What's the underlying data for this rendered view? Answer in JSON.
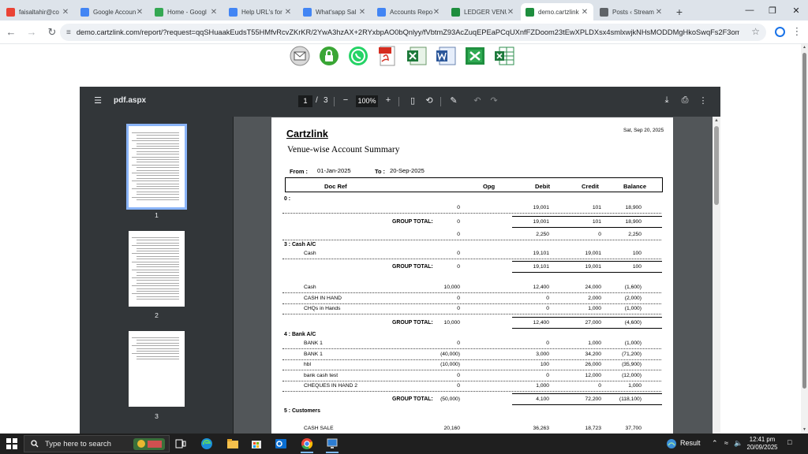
{
  "browser": {
    "tabs": [
      {
        "label": "faisaltahir@co",
        "favicon": "gmail-icon",
        "color": "#ea4335",
        "active": false
      },
      {
        "label": "Google Accoun",
        "favicon": "google-icon",
        "color": "#4285f4",
        "active": false
      },
      {
        "label": "Home - Googl",
        "favicon": "drive-icon",
        "color": "#34a853",
        "active": false
      },
      {
        "label": "Help URL's for",
        "favicon": "docs-icon",
        "color": "#4285f4",
        "active": false
      },
      {
        "label": "What'sapp Sal",
        "favicon": "docs-icon",
        "color": "#4285f4",
        "active": false
      },
      {
        "label": "Accounts Repo",
        "favicon": "docs-icon",
        "color": "#4285f4",
        "active": false
      },
      {
        "label": "LEDGER VENU",
        "favicon": "cartzlink-icon",
        "color": "#1e8e3e",
        "active": false
      },
      {
        "label": "demo.cartzlink",
        "favicon": "cartzlink-icon",
        "color": "#1e8e3e",
        "active": true
      },
      {
        "label": "Posts ‹ Stream",
        "favicon": "wordpress-icon",
        "color": "#5f6368",
        "active": false
      }
    ],
    "url": "demo.cartzlink.com/report/?request=qqSHuaakEudsT55HMfvRcvZKrKR/2YwA3hzAX+2RYxbpAO0bQnlyy/fVbtmZ93AcZuqEPEaPCqUXnfFZDoom23tEwXPLDXsx4smlxwjkNHsMODDMgHkoSwqFs2F3omAfvFGKnd..."
  },
  "viewer": {
    "filename": "pdf.aspx",
    "current_page": "1",
    "page_separator": "/",
    "total_pages": "3",
    "zoom": "100%",
    "thumbnails": [
      "1",
      "2",
      "3"
    ]
  },
  "report": {
    "brand": "Cartzlink",
    "print_date": "Sat, Sep 20, 2025",
    "title": "Venue-wise Account Summary",
    "from_label": "From :",
    "from_date": "01-Jan-2025",
    "to_label": "To :",
    "to_date": "20-Sep-2025",
    "columns": {
      "doc_ref": "Doc Ref",
      "opg": "Opg",
      "debit": "Debit",
      "credit": "Credit",
      "balance": "Balance"
    },
    "g0_header": "0 :",
    "g0_row": {
      "opg": "0",
      "debit": "19,001",
      "credit": "101",
      "balance": "18,900"
    },
    "g0_total": {
      "label": "GROUP TOTAL:",
      "opg": "0",
      "debit": "19,001",
      "credit": "101",
      "balance": "18,900"
    },
    "loose_row": {
      "opg": "0",
      "debit": "2,250",
      "credit": "0",
      "balance": "2,250"
    },
    "g3_header": "3 : Cash A/C",
    "g3_row": {
      "name": "Cash",
      "opg": "0",
      "debit": "19,101",
      "credit": "19,001",
      "balance": "100"
    },
    "g3_total": {
      "label": "GROUP TOTAL:",
      "opg": "0",
      "debit": "19,101",
      "credit": "19,001",
      "balance": "100"
    },
    "cash_rows": [
      {
        "name": "Cash",
        "opg": "10,000",
        "debit": "12,400",
        "credit": "24,000",
        "balance": "(1,600)"
      },
      {
        "name": "CASH IN HAND",
        "opg": "0",
        "debit": "0",
        "credit": "2,000",
        "balance": "(2,000)"
      },
      {
        "name": "CHQs in Hands",
        "opg": "0",
        "debit": "0",
        "credit": "1,000",
        "balance": "(1,000)"
      }
    ],
    "cash_total": {
      "label": "GROUP TOTAL:",
      "opg": "10,000",
      "debit": "12,400",
      "credit": "27,000",
      "balance": "(4,600)"
    },
    "g4_header": "4 : Bank A/C",
    "bank_rows": [
      {
        "name": "BANK 1",
        "opg": "0",
        "debit": "0",
        "credit": "1,000",
        "balance": "(1,000)"
      },
      {
        "name": "BANK 1",
        "opg": "(40,000)",
        "debit": "3,000",
        "credit": "34,200",
        "balance": "(71,200)"
      },
      {
        "name": "hbl",
        "opg": "(10,000)",
        "debit": "100",
        "credit": "26,000",
        "balance": "(35,900)"
      },
      {
        "name": "bank cash test",
        "opg": "0",
        "debit": "0",
        "credit": "12,000",
        "balance": "(12,000)"
      },
      {
        "name": "CHEQUES IN HAND 2",
        "opg": "0",
        "debit": "1,000",
        "credit": "0",
        "balance": "1,000"
      }
    ],
    "bank_total": {
      "label": "GROUP TOTAL:",
      "opg": "(50,000)",
      "debit": "4,100",
      "credit": "72,200",
      "balance": "(118,100)"
    },
    "g5_header": "5 : Customers",
    "customer_row": {
      "name": "CASH SALE",
      "opg": "20,160",
      "debit": "36,263",
      "credit": "18,723",
      "balance": "37,700"
    }
  },
  "taskbar": {
    "search_placeholder": "Type here to search",
    "weather": "Result",
    "time": "12:41 pm",
    "date": "20/09/2025"
  }
}
